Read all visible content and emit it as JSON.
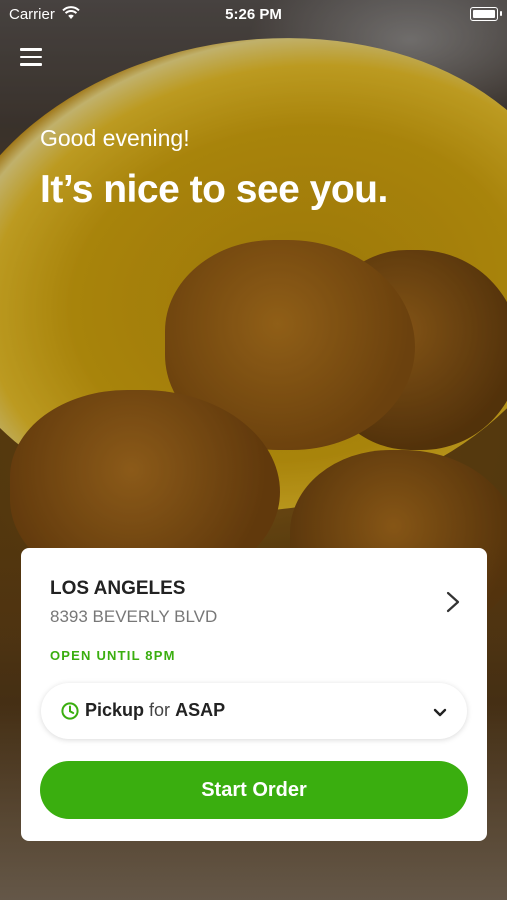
{
  "status_bar": {
    "carrier": "Carrier",
    "time": "5:26 PM"
  },
  "icons": {
    "menu": "hamburger-menu-icon",
    "wifi": "wifi-icon",
    "battery": "battery-icon",
    "chevron": "chevron-right-icon",
    "clock": "clock-icon",
    "dropdown": "chevron-down-icon"
  },
  "hero": {
    "greeting": "Good evening!",
    "headline": "It’s nice to see you."
  },
  "location": {
    "city": "LOS ANGELES",
    "address": "8393 BEVERLY BLVD",
    "hours": "OPEN UNTIL 8PM"
  },
  "order_mode": {
    "mode": "Pickup",
    "connector": "for",
    "time": "ASAP"
  },
  "actions": {
    "start_order": "Start Order"
  },
  "colors": {
    "accent": "#3aae0f"
  }
}
